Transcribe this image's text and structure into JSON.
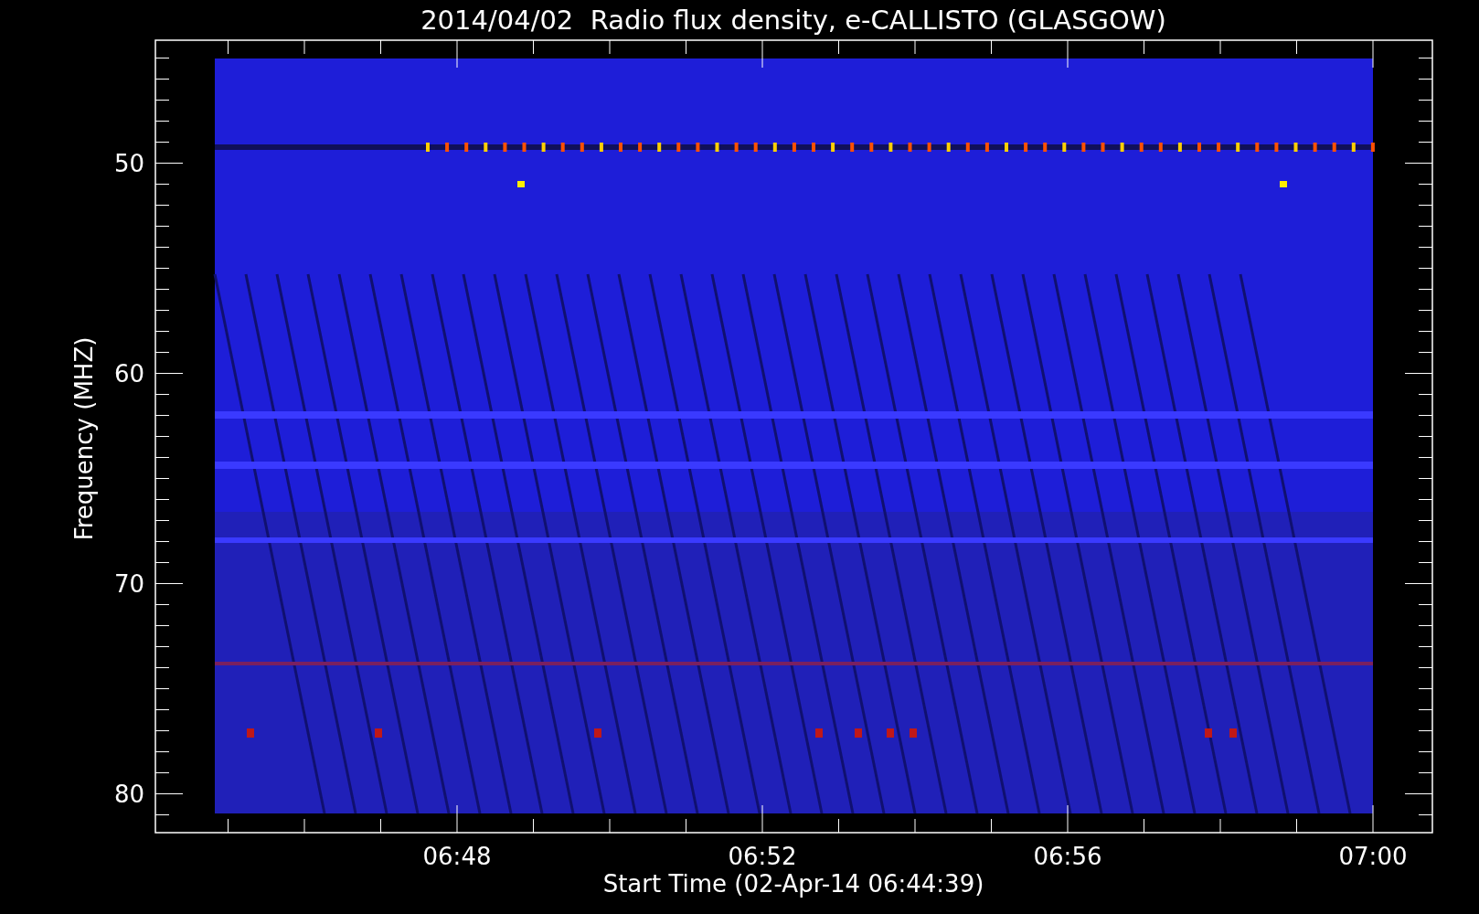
{
  "title": "2014/04/02  Radio flux density, e-CALLISTO (GLASGOW)",
  "y_axis": {
    "label": "Frequency (MHZ)",
    "ticks": [
      "50",
      "60",
      "70",
      "80"
    ]
  },
  "x_axis": {
    "label": "Start Time (02-Apr-14 06:44:39)",
    "ticks": [
      "06:48",
      "06:52",
      "06:56",
      "07:00"
    ]
  }
}
